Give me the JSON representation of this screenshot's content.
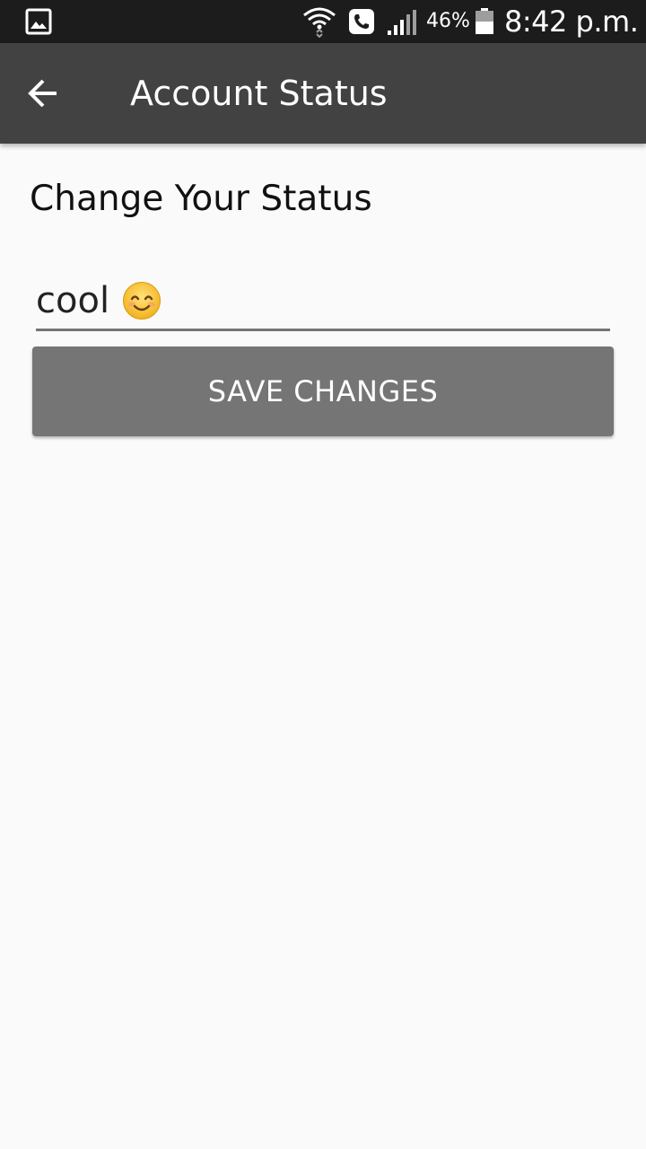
{
  "status_bar": {
    "battery_percent": "46%",
    "time": "8:42 p.m.",
    "icons": [
      "gallery-icon",
      "wifi-icon",
      "wifi-call-icon",
      "signal-icon",
      "battery-icon"
    ]
  },
  "app_bar": {
    "title": "Account Status",
    "back_icon": "arrow-left-icon"
  },
  "content": {
    "section_title": "Change Your Status",
    "status_value": "cool",
    "status_emoji": "smiling-face-emoji",
    "save_label": "SAVE CHANGES"
  },
  "colors": {
    "status_bar_bg": "#1c1c1c",
    "app_bar_bg": "#424242",
    "page_bg": "#fafafa",
    "button_bg": "#757575",
    "underline": "#757575"
  }
}
